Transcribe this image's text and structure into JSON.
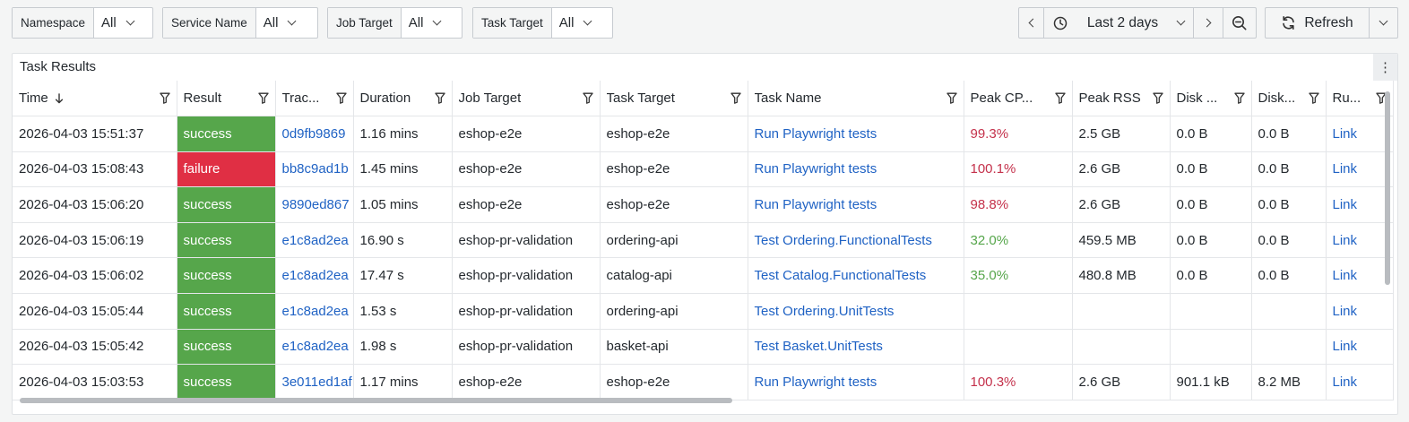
{
  "variables": [
    {
      "label": "Namespace",
      "value": "All"
    },
    {
      "label": "Service Name",
      "value": "All"
    },
    {
      "label": "Job Target",
      "value": "All"
    },
    {
      "label": "Task Target",
      "value": "All"
    }
  ],
  "time_picker": {
    "range": "Last 2 days"
  },
  "refresh": {
    "label": "Refresh"
  },
  "panel": {
    "title": "Task Results",
    "menu_glyph": "⋮",
    "columns": [
      "Time",
      "Result",
      "Trac...",
      "Duration",
      "Job Target",
      "Task Target",
      "Task Name",
      "Peak CP...",
      "Peak RSS",
      "Disk ...",
      "Disk...",
      "Ru..."
    ],
    "rows": [
      {
        "time": "2026-04-03 15:51:37",
        "result": "success",
        "trace": "0d9fb9869",
        "duration": "1.16 mins",
        "job": "eshop-e2e",
        "task": "eshop-e2e",
        "name": "Run Playwright tests",
        "cpu": "99.3%",
        "cpu_level": "red",
        "rss": "2.5 GB",
        "disk_r": "0.0 B",
        "disk_w": "0.0 B",
        "run": "Link"
      },
      {
        "time": "2026-04-03 15:08:43",
        "result": "failure",
        "trace": "bb8c9ad1b",
        "duration": "1.45 mins",
        "job": "eshop-e2e",
        "task": "eshop-e2e",
        "name": "Run Playwright tests",
        "cpu": "100.1%",
        "cpu_level": "red",
        "rss": "2.6 GB",
        "disk_r": "0.0 B",
        "disk_w": "0.0 B",
        "run": "Link"
      },
      {
        "time": "2026-04-03 15:06:20",
        "result": "success",
        "trace": "9890ed867",
        "duration": "1.05 mins",
        "job": "eshop-e2e",
        "task": "eshop-e2e",
        "name": "Run Playwright tests",
        "cpu": "98.8%",
        "cpu_level": "red",
        "rss": "2.6 GB",
        "disk_r": "0.0 B",
        "disk_w": "0.0 B",
        "run": "Link"
      },
      {
        "time": "2026-04-03 15:06:19",
        "result": "success",
        "trace": "e1c8ad2ea",
        "duration": "16.90 s",
        "job": "eshop-pr-validation",
        "task": "ordering-api",
        "name": "Test Ordering.FunctionalTests",
        "cpu": "32.0%",
        "cpu_level": "green",
        "rss": "459.5 MB",
        "disk_r": "0.0 B",
        "disk_w": "0.0 B",
        "run": "Link"
      },
      {
        "time": "2026-04-03 15:06:02",
        "result": "success",
        "trace": "e1c8ad2ea",
        "duration": "17.47 s",
        "job": "eshop-pr-validation",
        "task": "catalog-api",
        "name": "Test Catalog.FunctionalTests",
        "cpu": "35.0%",
        "cpu_level": "green",
        "rss": "480.8 MB",
        "disk_r": "0.0 B",
        "disk_w": "0.0 B",
        "run": "Link"
      },
      {
        "time": "2026-04-03 15:05:44",
        "result": "success",
        "trace": "e1c8ad2ea",
        "duration": "1.53 s",
        "job": "eshop-pr-validation",
        "task": "ordering-api",
        "name": "Test Ordering.UnitTests",
        "cpu": "",
        "cpu_level": "",
        "rss": "",
        "disk_r": "",
        "disk_w": "",
        "run": "Link"
      },
      {
        "time": "2026-04-03 15:05:42",
        "result": "success",
        "trace": "e1c8ad2ea",
        "duration": "1.98 s",
        "job": "eshop-pr-validation",
        "task": "basket-api",
        "name": "Test Basket.UnitTests",
        "cpu": "",
        "cpu_level": "",
        "rss": "",
        "disk_r": "",
        "disk_w": "",
        "run": "Link"
      },
      {
        "time": "2026-04-03 15:03:53",
        "result": "success",
        "trace": "3e011ed1af",
        "duration": "1.17 mins",
        "job": "eshop-e2e",
        "task": "eshop-e2e",
        "name": "Run Playwright tests",
        "cpu": "100.3%",
        "cpu_level": "red",
        "rss": "2.6 GB",
        "disk_r": "901.1 kB",
        "disk_w": "8.2 MB",
        "run": "Link"
      }
    ]
  },
  "colors": {
    "success": "#56a64b",
    "failure": "#e02f44",
    "link": "#1f62c4",
    "cpu_high": "#c4314b",
    "cpu_low": "#56a64b"
  },
  "icons": {
    "sort": "arrow-down-icon",
    "filter": "funnel-icon",
    "clock": "clock-icon",
    "zoom": "zoom-out-icon",
    "refresh": "refresh-icon"
  }
}
